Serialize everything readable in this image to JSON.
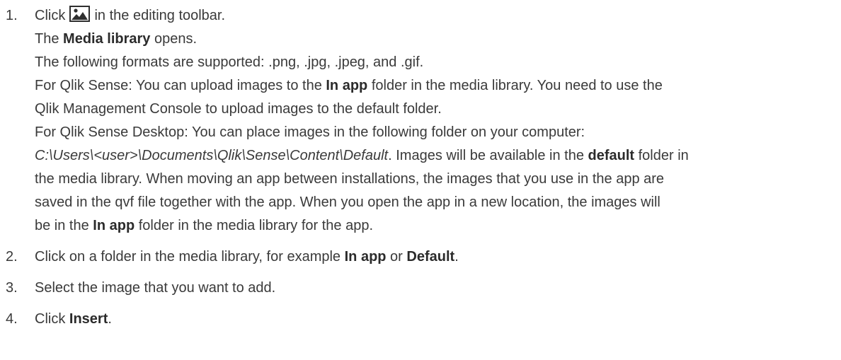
{
  "steps": [
    {
      "number": "1.",
      "icon": "image-icon",
      "click_prefix": "Click",
      "click_suffix": " in the editing toolbar.",
      "opens_prefix": "The ",
      "opens_bold": "Media library",
      "opens_suffix": " opens.",
      "formats": "The following formats are supported: .png, .jpg, .jpeg, and .gif.",
      "qs_prefix": "For Qlik Sense: You can upload images to the ",
      "qs_bold": "In app",
      "qs_mid": " folder in the media library. You need to use the",
      "qs_line2": "Qlik Management Console to upload images to the default folder.",
      "qsd_line1": "For Qlik Sense Desktop: You can place images in the following folder on your computer:",
      "qsd_path": "C:\\Users\\<user>\\Documents\\Qlik\\Sense\\Content\\Default",
      "qsd_after_path": ". Images will be available in the ",
      "qsd_bold": "default",
      "qsd_after_bold": " folder in",
      "qsd_line3": "the media library. When moving an app between installations, the images that you use in the app are",
      "qsd_line4": "saved in the qvf file together with the app. When you open the app in a new location, the images will",
      "qsd_line5_prefix": "be in the ",
      "qsd_line5_bold": "In app",
      "qsd_line5_suffix": " folder in the media library for the app."
    },
    {
      "number": "2.",
      "prefix": "Click on a folder in the media library, for example ",
      "bold1": "In app",
      "mid": " or ",
      "bold2": "Default",
      "suffix": "."
    },
    {
      "number": "3.",
      "text": "Select the image that you want to add."
    },
    {
      "number": "4.",
      "prefix": "Click ",
      "bold": "Insert",
      "suffix": "."
    }
  ]
}
